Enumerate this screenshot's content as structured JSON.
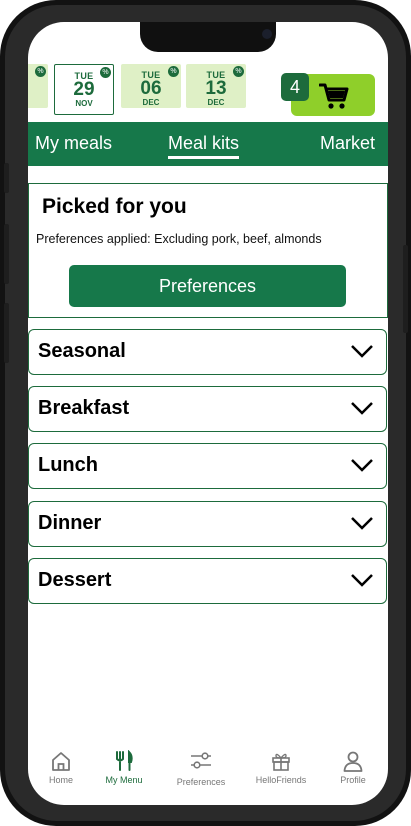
{
  "colors": {
    "brand_green": "#16784a",
    "light_green": "#dff0c6",
    "cart_green": "#8fcf2a"
  },
  "date_strip": [
    {
      "day": "",
      "num": "",
      "month": "",
      "discount_icon": "%"
    },
    {
      "day": "TUE",
      "num": "29",
      "month": "NOV",
      "discount_icon": "%",
      "selected": true
    },
    {
      "day": "TUE",
      "num": "06",
      "month": "DEC",
      "discount_icon": "%"
    },
    {
      "day": "TUE",
      "num": "13",
      "month": "DEC",
      "discount_icon": "%"
    }
  ],
  "cart": {
    "count": "4",
    "icon": "cart-icon"
  },
  "tabs": [
    {
      "label": "My meals"
    },
    {
      "label": "Meal kits",
      "active": true
    },
    {
      "label": "Market"
    }
  ],
  "picked": {
    "title": "Picked for you",
    "subtitle": "Preferences applied: Excluding pork, beef, almonds",
    "button": "Preferences"
  },
  "categories": [
    {
      "label": "Seasonal"
    },
    {
      "label": "Breakfast"
    },
    {
      "label": "Lunch"
    },
    {
      "label": "Dinner"
    },
    {
      "label": "Dessert"
    }
  ],
  "bottom_nav": [
    {
      "label": "Home",
      "icon": "home-icon"
    },
    {
      "label": "My Menu",
      "icon": "fork-knife-icon",
      "active": true
    },
    {
      "label": "Preferences",
      "icon": "sliders-icon"
    },
    {
      "label": "HelloFriends",
      "icon": "gift-icon"
    },
    {
      "label": "Profile",
      "icon": "person-icon"
    }
  ]
}
